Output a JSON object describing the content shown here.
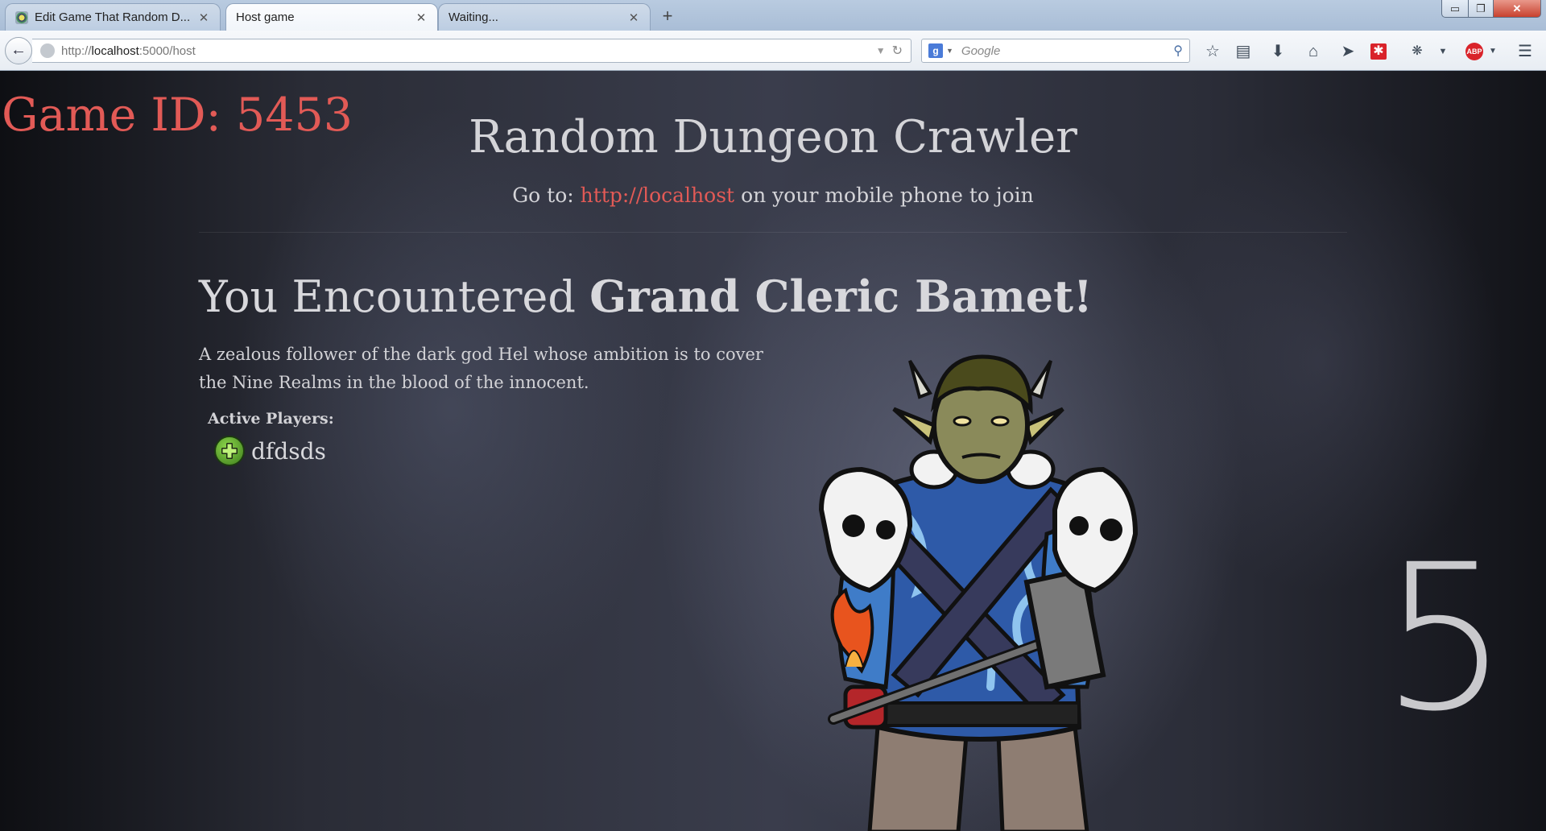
{
  "browser": {
    "tabs": [
      {
        "title": "Edit Game That Random D...",
        "active": false
      },
      {
        "title": "Host game",
        "active": true
      },
      {
        "title": "Waiting...",
        "active": false
      }
    ],
    "new_tab": "+",
    "window_controls": {
      "minimize": "▭",
      "restore": "❐",
      "close": "✕"
    },
    "url_prefix": "http://",
    "url_host": "localhost",
    "url_rest": ":5000/host",
    "search_engine": "g",
    "search_placeholder": "Google",
    "icons": [
      "star-icon",
      "reading-list-icon",
      "download-icon",
      "home-icon",
      "send-icon",
      "addon-icon",
      "bug-icon",
      "menu-dropdown-icon",
      "adblock-icon",
      "hamburger-menu-icon"
    ]
  },
  "page": {
    "game_id_label": "Game ID:",
    "game_id": "5453",
    "title": "Random Dungeon Crawler",
    "join_prefix": "Go to:",
    "join_link": "http://localhost",
    "join_suffix": "on your mobile phone to join",
    "encounter_prefix": "You Encountered",
    "monster_name": "Grand Cleric Bamet",
    "encounter_suffix": "!",
    "description": "A zealous follower of the dark god Hel whose ambition is to cover the Nine Realms in the blood of the innocent.",
    "players_label": "Active Players:",
    "players": [
      {
        "name": "dfdsds"
      }
    ],
    "countdown": "5"
  },
  "colors": {
    "accent": "#e25a56",
    "text": "#d4d4d8",
    "player_icon": "#5aa62a"
  }
}
